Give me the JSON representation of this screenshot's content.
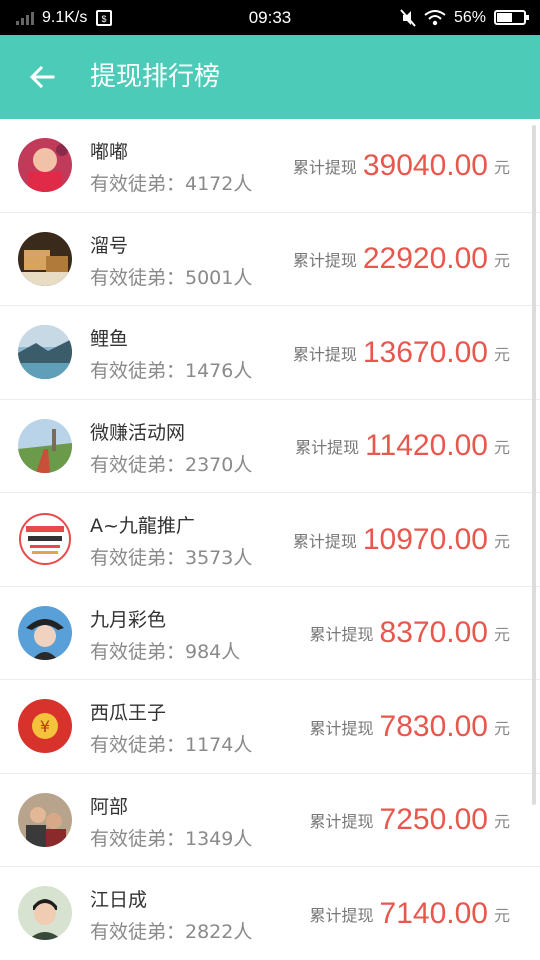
{
  "status_bar": {
    "net_speed": "9.1K/s",
    "time": "09:33",
    "battery": "56%",
    "battery_level": 0.56,
    "icons": [
      "signal-icon",
      "sd-card-icon",
      "mute-icon",
      "wifi-icon",
      "battery-icon"
    ]
  },
  "header": {
    "title": "提现排行榜",
    "back_icon": "arrow-left-icon",
    "bg_color": "#4ccbb8"
  },
  "colors": {
    "amount": "#e8574d"
  },
  "ranking": [
    {
      "name": "嘟嘟",
      "disciples": "有效徒弟：4172人",
      "label": "累计提现",
      "amount": "39040.00",
      "unit": "元"
    },
    {
      "name": "溜号",
      "disciples": "有效徒弟：5001人",
      "label": "累计提现",
      "amount": "22920.00",
      "unit": "元"
    },
    {
      "name": "鲤鱼",
      "disciples": "有效徒弟：1476人",
      "label": "累计提现",
      "amount": "13670.00",
      "unit": "元"
    },
    {
      "name": "微赚活动网",
      "disciples": "有效徒弟：2370人",
      "label": "累计提现",
      "amount": "11420.00",
      "unit": "元"
    },
    {
      "name": "A~九龍推广",
      "disciples": "有效徒弟：3573人",
      "label": "累计提现",
      "amount": "10970.00",
      "unit": "元"
    },
    {
      "name": "九月彩色",
      "disciples": "有效徒弟：984人",
      "label": "累计提现",
      "amount": "8370.00",
      "unit": "元"
    },
    {
      "name": "西瓜王子",
      "disciples": "有效徒弟：1174人",
      "label": "累计提现",
      "amount": "7830.00",
      "unit": "元"
    },
    {
      "name": "阿部",
      "disciples": "有效徒弟：1349人",
      "label": "累计提现",
      "amount": "7250.00",
      "unit": "元"
    },
    {
      "name": "江日成",
      "disciples": "有效徒弟：2822人",
      "label": "累计提现",
      "amount": "7140.00",
      "unit": "元"
    }
  ]
}
